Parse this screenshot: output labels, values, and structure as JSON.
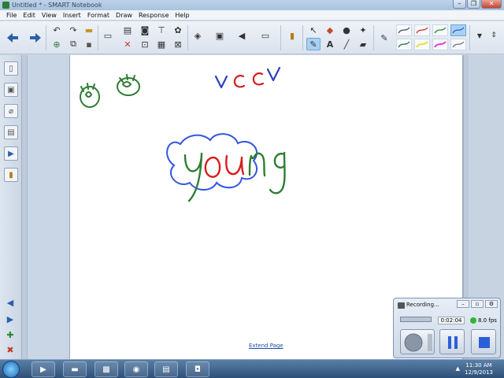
{
  "window": {
    "title": "Untitled * - SMART Notebook",
    "minimize": "–",
    "maximize": "❐",
    "close": "✕"
  },
  "menu": [
    "File",
    "Edit",
    "View",
    "Insert",
    "Format",
    "Draw",
    "Response",
    "Help"
  ],
  "icons": {
    "back": "arrow-left-icon",
    "forward": "arrow-right-icon",
    "undo": "undo-icon",
    "redo": "redo-icon",
    "delete": "delete-x-icon",
    "select": "pointer-icon",
    "pen": "pen-icon",
    "text": "text-a-icon",
    "line": "line-icon",
    "eraser": "eraser-icon"
  },
  "colors": {
    "ink_green": "#2e7d32",
    "ink_blue": "#2b3fbf",
    "ink_red": "#d81e1e",
    "cloud_blue": "#3355e0",
    "selected_tool": "#a9d0f2"
  },
  "canvas": {
    "handwriting": [
      "vccv",
      "young"
    ],
    "extend_page": "Extend Page"
  },
  "recorder": {
    "title": "Recording...",
    "time": "0:02:04",
    "fps": "8.0 fps"
  },
  "taskbar": {
    "clock_time": "11:30 AM",
    "clock_date": "12/9/2013"
  }
}
